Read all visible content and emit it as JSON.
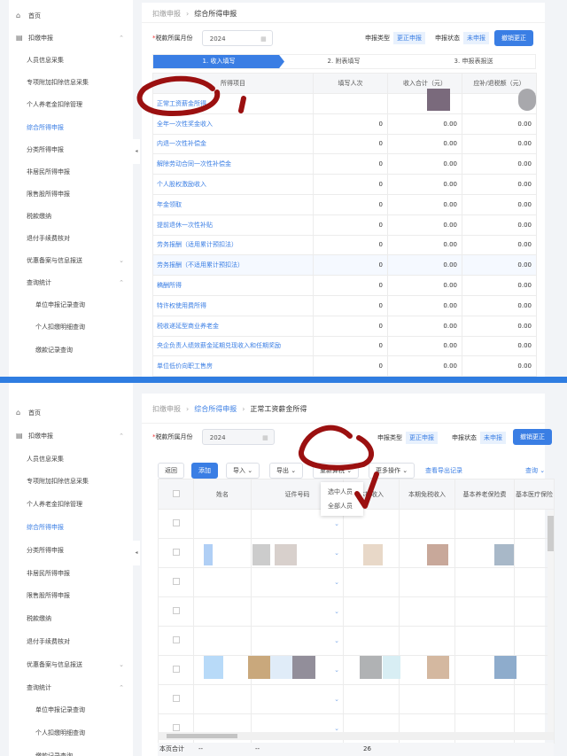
{
  "top": {
    "sidebar": [
      {
        "label": "首页",
        "icon": "home-icon"
      },
      {
        "label": "扣缴申报",
        "icon": "report-icon",
        "chevron": "up"
      },
      {
        "label": "人员信息采集"
      },
      {
        "label": "专项附加扣除信息采集"
      },
      {
        "label": "个人养老金扣除管理"
      },
      {
        "label": "综合所得申报",
        "active": true
      },
      {
        "label": "分类所得申报"
      },
      {
        "label": "非居民所得申报"
      },
      {
        "label": "限售股所得申报"
      },
      {
        "label": "税款缴纳"
      },
      {
        "label": "退付手续费核对"
      },
      {
        "label": "优惠备案与信息报送",
        "chevron": "down"
      },
      {
        "label": "查询统计",
        "chevron": "up"
      },
      {
        "label": "单位申报记录查询",
        "sub": true
      },
      {
        "label": "个人扣缴明细查询",
        "sub": true
      },
      {
        "label": "缴款记录查询",
        "sub": true
      }
    ],
    "breadcrumb": [
      "扣缴申报",
      "综合所得申报"
    ],
    "month_label": "税款所属月份",
    "month_value": "2024",
    "report_type_label": "申报类型",
    "report_type": "更正申报",
    "status_label": "申报状态",
    "status": "未申报",
    "cancel_button": "撤销更正",
    "steps": [
      "1. 收入填写",
      "2. 附表填写",
      "3. 申报表报送"
    ],
    "columns": [
      "所得项目",
      "填写人次",
      "收入合计（元）",
      "应补/退税额（元）"
    ],
    "rows": [
      [
        "正常工资薪金所得",
        "",
        "",
        ""
      ],
      [
        "全年一次性奖金收入",
        "0",
        "0.00",
        "0.00"
      ],
      [
        "内退一次性补偿金",
        "0",
        "0.00",
        "0.00"
      ],
      [
        "解除劳动合同一次性补偿金",
        "0",
        "0.00",
        "0.00"
      ],
      [
        "个人股权激励收入",
        "0",
        "0.00",
        "0.00"
      ],
      [
        "年金领取",
        "0",
        "0.00",
        "0.00"
      ],
      [
        "提前退休一次性补贴",
        "0",
        "0.00",
        "0.00"
      ],
      [
        "劳务报酬（适用累计预扣法）",
        "0",
        "0.00",
        "0.00"
      ],
      [
        "劳务报酬（不适用累计预扣法）",
        "0",
        "0.00",
        "0.00"
      ],
      [
        "稿酬所得",
        "0",
        "0.00",
        "0.00"
      ],
      [
        "特许权使用费所得",
        "0",
        "0.00",
        "0.00"
      ],
      [
        "税收递延型商业养老金",
        "0",
        "0.00",
        "0.00"
      ],
      [
        "央企负责人绩效薪金延期兑现收入和任期奖励",
        "0",
        "0.00",
        "0.00"
      ],
      [
        "单位低价向职工售房",
        "0",
        "0.00",
        "0.00"
      ]
    ]
  },
  "bottom": {
    "breadcrumb": [
      "扣缴申报",
      "综合所得申报",
      "正常工资薪金所得"
    ],
    "toolbar": {
      "back": "返回",
      "add": "添加",
      "import": "导入",
      "export": "导出",
      "recalc": "重新算税",
      "more": "更多操作",
      "export_log": "查看导出记录",
      "query": "查询"
    },
    "recalc_menu": [
      "选中人员",
      "全部人员"
    ],
    "columns": [
      "姓名",
      "证件号码",
      "本期收入",
      "本期免税收入",
      "基本养老保险费",
      "基本医疗保险"
    ],
    "footer_label": "本页合计",
    "footer_values": [
      "--",
      "--",
      "26"
    ]
  },
  "colors": {
    "accent": "#3a7ee4",
    "annotation": "#9b1010",
    "separator": "#2f7de1"
  }
}
